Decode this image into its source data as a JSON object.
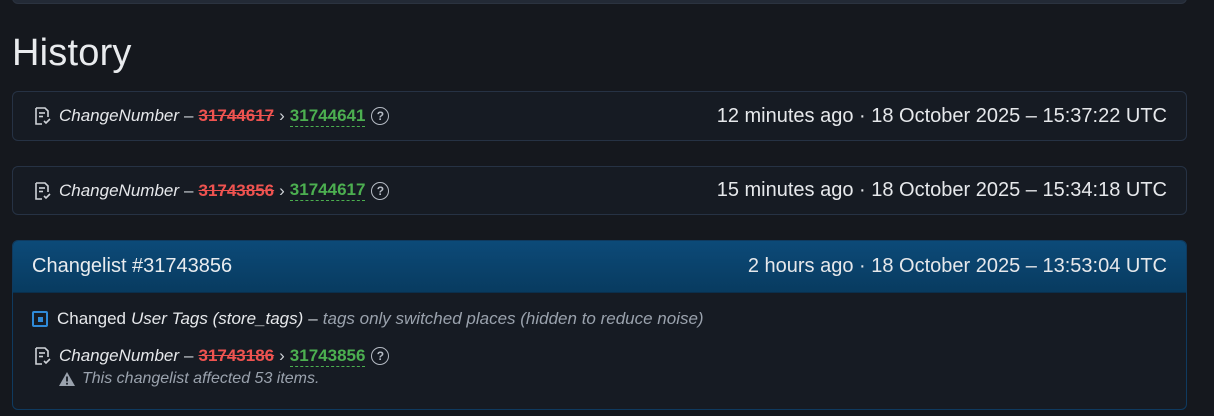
{
  "page": {
    "heading": "History"
  },
  "history": [
    {
      "field": "ChangeNumber",
      "separator": "–",
      "old_value": "31744617",
      "arrow": "›",
      "new_value": "31744641",
      "time": "12 minutes ago · 18 October 2025 – 15:37:22 UTC"
    },
    {
      "field": "ChangeNumber",
      "separator": "–",
      "old_value": "31743856",
      "arrow": "›",
      "new_value": "31744617",
      "time": "15 minutes ago · 18 October 2025 – 15:34:18 UTC"
    }
  ],
  "changelist": {
    "title": "Changelist #31743856",
    "time": "2 hours ago · 18 October 2025 – 13:53:04 UTC",
    "tags_change": {
      "prefix": "Changed",
      "field": "User Tags (store_tags)",
      "separator": "–",
      "note": "tags only switched places (hidden to reduce noise)"
    },
    "number_change": {
      "field": "ChangeNumber",
      "separator": "–",
      "old_value": "31743186",
      "arrow": "›",
      "new_value": "31743856"
    },
    "warning": "This changelist affected 53 items."
  },
  "icons": {
    "history_icon": "document-check-icon",
    "help": "question-circle-icon",
    "tags": "square-dot-icon",
    "warning": "warning-triangle-icon"
  },
  "colors": {
    "old_value": "#ef5350",
    "new_value": "#4caf50",
    "header_bg": "#0c4a78",
    "accent": "#2f8ad8"
  }
}
